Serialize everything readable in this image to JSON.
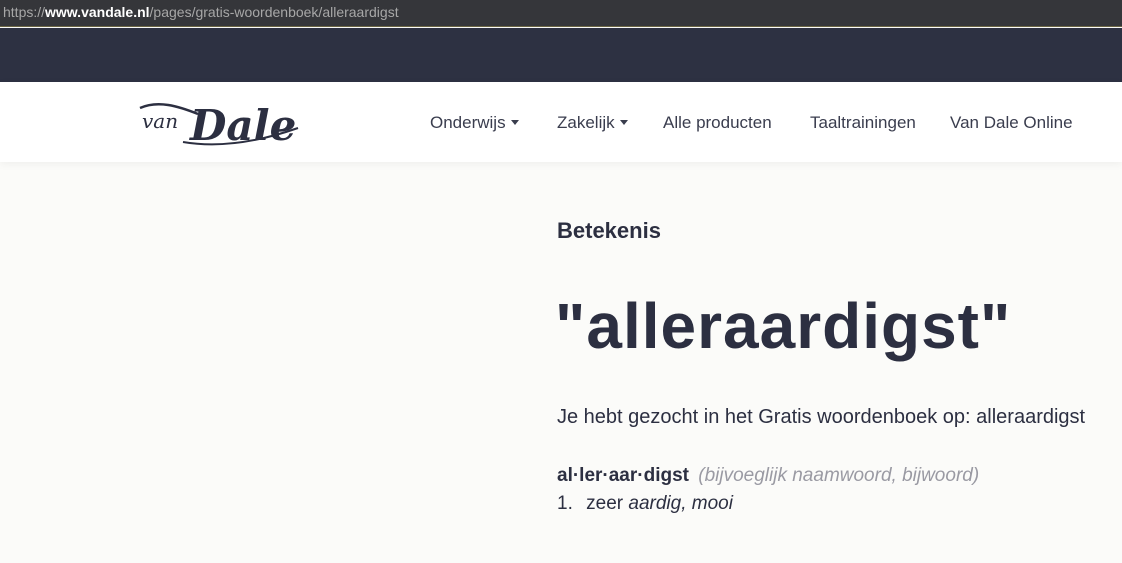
{
  "browser": {
    "url_scheme": "https://",
    "url_host": "www.vandale.nl",
    "url_path": "/pages/gratis-woordenboek/alleraardigst"
  },
  "header": {
    "logo_small": "van",
    "logo_large": "Dale",
    "nav": [
      {
        "label": "Onderwijs",
        "has_dropdown": true
      },
      {
        "label": "Zakelijk",
        "has_dropdown": true
      },
      {
        "label": "Alle producten",
        "has_dropdown": false
      },
      {
        "label": "Taaltrainingen",
        "has_dropdown": false
      },
      {
        "label": "Van Dale Online",
        "has_dropdown": false
      }
    ]
  },
  "main": {
    "section_label": "Betekenis",
    "word_title": "\"alleraardigst\"",
    "searched_text": "Je hebt gezocht in het Gratis woordenboek op: alleraardigst",
    "entry": {
      "syllables": "al·ler·aar·digst",
      "part_of_speech": "(bijvoeglijk naamwoord, bijwoord)",
      "definitions": [
        {
          "number": "1.",
          "plain": "zeer",
          "italic": "aardig, mooi"
        }
      ]
    }
  },
  "colors": {
    "top_band": "#2d3142",
    "text_dark": "#2c2f41",
    "text_muted": "#9a9aa3",
    "page_bg": "#fbfbf9"
  }
}
